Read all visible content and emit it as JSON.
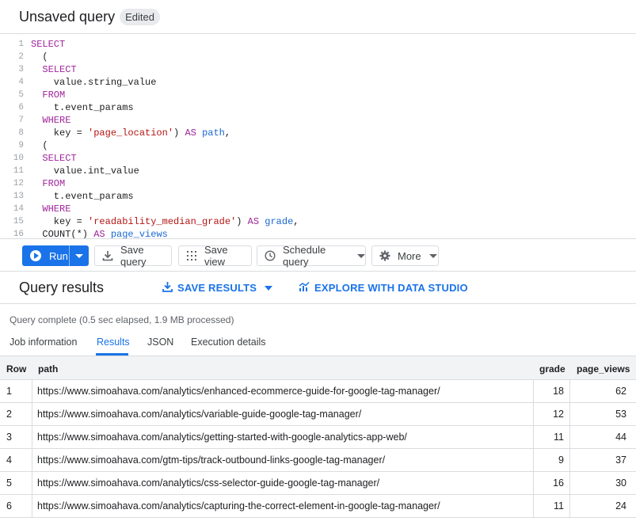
{
  "header": {
    "title": "Unsaved query",
    "badge": "Edited"
  },
  "editor": {
    "line_numbers": [
      "1",
      "2",
      "3",
      "4",
      "5",
      "6",
      "7",
      "8",
      "9",
      "10",
      "11",
      "12",
      "13",
      "14",
      "15",
      "16"
    ]
  },
  "toolbar": {
    "run_label": "Run",
    "save_query_label": "Save query",
    "save_view_label": "Save view",
    "schedule_label": "Schedule query",
    "more_label": "More"
  },
  "results": {
    "title": "Query results",
    "save_results_label": "SAVE RESULTS",
    "explore_label": "EXPLORE WITH DATA STUDIO",
    "status": "Query complete (0.5 sec elapsed, 1.9 MB processed)",
    "tabs": [
      "Job information",
      "Results",
      "JSON",
      "Execution details"
    ],
    "active_tab": "Results"
  },
  "table": {
    "columns": [
      "Row",
      "path",
      "grade",
      "page_views"
    ],
    "rows": [
      {
        "row": "1",
        "path": "https://www.simoahava.com/analytics/enhanced-ecommerce-guide-for-google-tag-manager/",
        "grade": "18",
        "page_views": "62"
      },
      {
        "row": "2",
        "path": "https://www.simoahava.com/analytics/variable-guide-google-tag-manager/",
        "grade": "12",
        "page_views": "53"
      },
      {
        "row": "3",
        "path": "https://www.simoahava.com/analytics/getting-started-with-google-analytics-app-web/",
        "grade": "11",
        "page_views": "44"
      },
      {
        "row": "4",
        "path": "https://www.simoahava.com/gtm-tips/track-outbound-links-google-tag-manager/",
        "grade": "9",
        "page_views": "37"
      },
      {
        "row": "5",
        "path": "https://www.simoahava.com/analytics/css-selector-guide-google-tag-manager/",
        "grade": "16",
        "page_views": "30"
      },
      {
        "row": "6",
        "path": "https://www.simoahava.com/analytics/capturing-the-correct-element-in-google-tag-manager/",
        "grade": "11",
        "page_views": "24"
      }
    ]
  },
  "colors": {
    "accent": "#1a73e8",
    "keyword": "#a0249b",
    "string": "#b31412",
    "alias": "#1967d2"
  }
}
